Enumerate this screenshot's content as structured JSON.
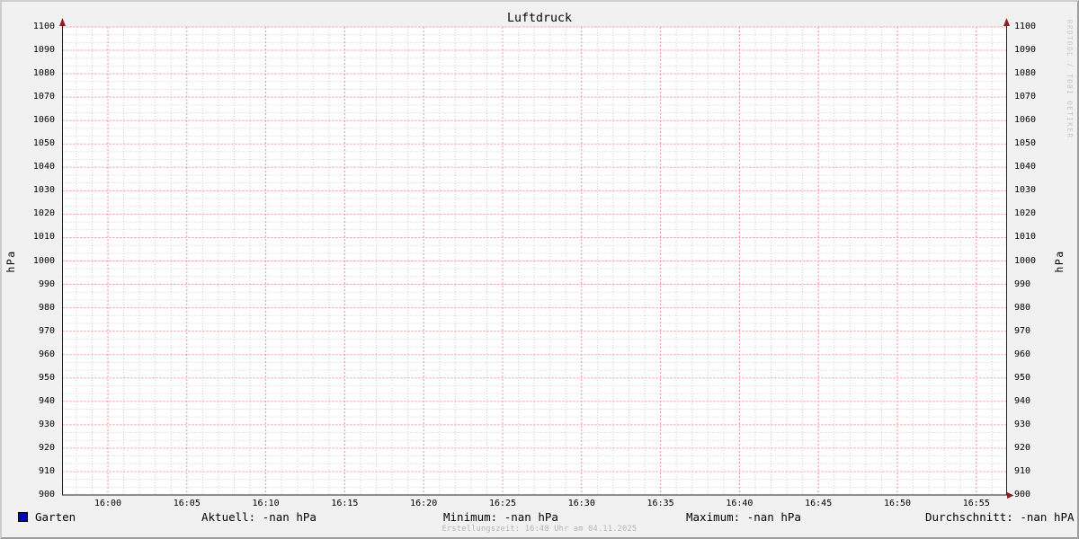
{
  "chart_data": {
    "type": "line",
    "title": "Luftdruck",
    "ylabel_left": "hPa",
    "ylabel_right": "hPa",
    "ylim": [
      900,
      1100
    ],
    "y_tick_step": 10,
    "y_ticks": [
      1100,
      1090,
      1080,
      1070,
      1060,
      1050,
      1040,
      1030,
      1020,
      1010,
      1000,
      990,
      980,
      970,
      960,
      950,
      940,
      930,
      920,
      910,
      900
    ],
    "x_tick_labels": [
      "16:00",
      "16:05",
      "16:10",
      "16:15",
      "16:20",
      "16:25",
      "16:30",
      "16:35",
      "16:40",
      "16:45",
      "16:50",
      "16:55"
    ],
    "grid": {
      "plot_background": "#ffffff",
      "major_color": "#f09494",
      "minor_color": "#cfcfcf",
      "axis_color": "#222222",
      "arrow_color": "#8b1e1e",
      "grid_on": true,
      "legend_position": "bottom"
    },
    "series": [
      {
        "name": "Garten",
        "color": "#0000cc",
        "values": []
      }
    ],
    "stats": {
      "aktuell": "Aktuell: -nan hPa",
      "minimum": "Minimum: -nan hPa",
      "maximum": "Maximum: -nan hPa",
      "durchschnitt": "Durchschnitt: -nan hPA"
    }
  },
  "footer": {
    "erstellungszeit": "Erstellungszeit: 16:48 Uhr am 04.11.2025"
  },
  "watermark": "RRDTOOL / TOBI OETIKER"
}
